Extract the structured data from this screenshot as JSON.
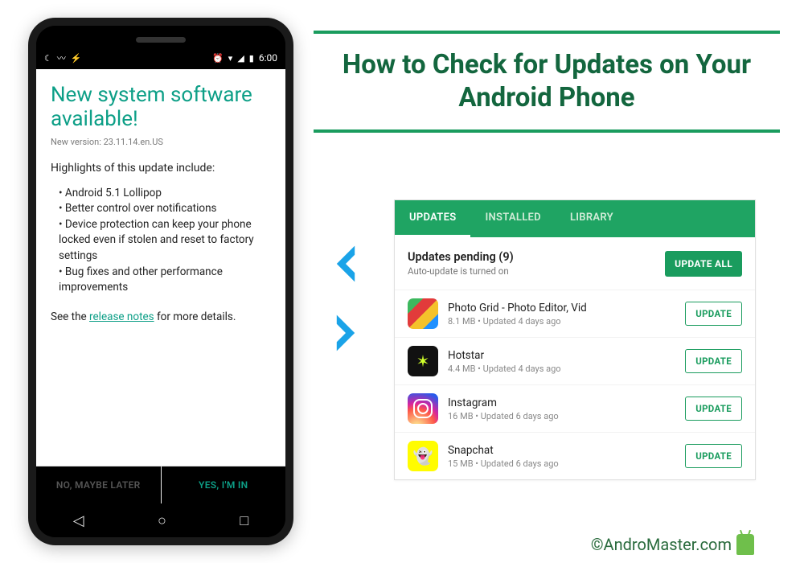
{
  "statusbar": {
    "time": "6:00"
  },
  "system_update": {
    "title": "New system software available!",
    "version": "New version: 23.11.14.en.US",
    "highlights_label": "Highlights of this update include:",
    "bullets": [
      "Android 5.1 Lollipop",
      "Better control over notifications",
      "Device protection can keep your phone locked even if stolen and reset to factory settings",
      "Bug fixes and other performance improvements"
    ],
    "see_prefix": "See the ",
    "see_link": "release notes",
    "see_suffix": " for more details.",
    "btn_no": "NO, MAYBE LATER",
    "btn_yes": "YES, I'M IN"
  },
  "heading": "How to Check for Updates on Your Android Phone",
  "tabs": {
    "updates": "UPDATES",
    "installed": "INSTALLED",
    "library": "LIBRARY"
  },
  "pending": {
    "title": "Updates pending (9)",
    "sub": "Auto-update is turned on",
    "update_all": "UPDATE ALL",
    "update_label": "UPDATE"
  },
  "apps": [
    {
      "name": "Photo Grid - Photo Editor, Vid",
      "sub": "8.1 MB  •  Updated 4 days ago",
      "icon": "photogrid"
    },
    {
      "name": "Hotstar",
      "sub": "4.4 MB  •  Updated 4 days ago",
      "icon": "hotstar"
    },
    {
      "name": "Instagram",
      "sub": "16 MB  •  Updated 6 days ago",
      "icon": "instagram"
    },
    {
      "name": "Snapchat",
      "sub": "15 MB  •  Updated 6 days ago",
      "icon": "snapchat"
    }
  ],
  "credit": "©AndroMaster.com"
}
